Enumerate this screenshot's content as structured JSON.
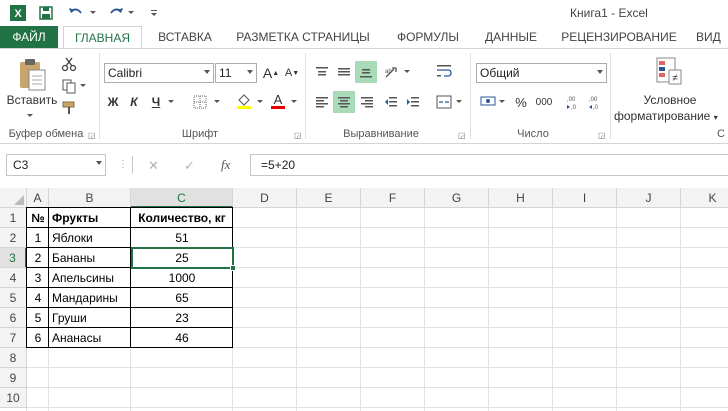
{
  "window": {
    "title": "Книга1 - Excel"
  },
  "quick_access": {
    "icons": [
      "excel-logo-icon",
      "save-icon",
      "undo-icon",
      "redo-icon",
      "customize-icon"
    ]
  },
  "tabs": [
    "ФАЙЛ",
    "ГЛАВНАЯ",
    "ВСТАВКА",
    "РАЗМЕТКА СТРАНИЦЫ",
    "ФОРМУЛЫ",
    "ДАННЫЕ",
    "РЕЦЕНЗИРОВАНИЕ",
    "ВИД"
  ],
  "ribbon": {
    "clipboard": {
      "paste_label": "Вставить",
      "group_label": "Буфер обмена"
    },
    "font": {
      "font_name": "Calibri",
      "font_size": "11",
      "bold": "Ж",
      "italic": "К",
      "underline": "Ч",
      "grow": "A",
      "shrink": "A",
      "font_color": "A",
      "group_label": "Шрифт"
    },
    "alignment": {
      "group_label": "Выравнивание"
    },
    "number": {
      "format": "Общий",
      "percent": "%",
      "comma": "000",
      "group_label": "Число"
    },
    "styles": {
      "conditional_line1": "Условное",
      "conditional_line2": "форматирование",
      "group_label": "С"
    }
  },
  "formula_bar": {
    "name_box": "C3",
    "cancel": "✕",
    "enter": "✓",
    "fx": "fx",
    "formula": "=5+20"
  },
  "sheet": {
    "columns": [
      "A",
      "B",
      "C",
      "D",
      "E",
      "F",
      "G",
      "H",
      "I",
      "J",
      "K"
    ],
    "rows": [
      "1",
      "2",
      "3",
      "4",
      "5",
      "6",
      "7",
      "8",
      "9",
      "10"
    ],
    "active_cell": "C3",
    "headers": [
      "№",
      "Фрукты",
      "Количество, кг"
    ],
    "data": [
      [
        "1",
        "Яблоки",
        "51"
      ],
      [
        "2",
        "Бананы",
        "25"
      ],
      [
        "3",
        "Апельсины",
        "1000"
      ],
      [
        "4",
        "Мандарины",
        "65"
      ],
      [
        "5",
        "Груши",
        "23"
      ],
      [
        "6",
        "Ананасы",
        "46"
      ]
    ]
  },
  "colors": {
    "accent": "#217346",
    "header_bg": "#f3f3f3",
    "grid": "#e2e2e2"
  }
}
